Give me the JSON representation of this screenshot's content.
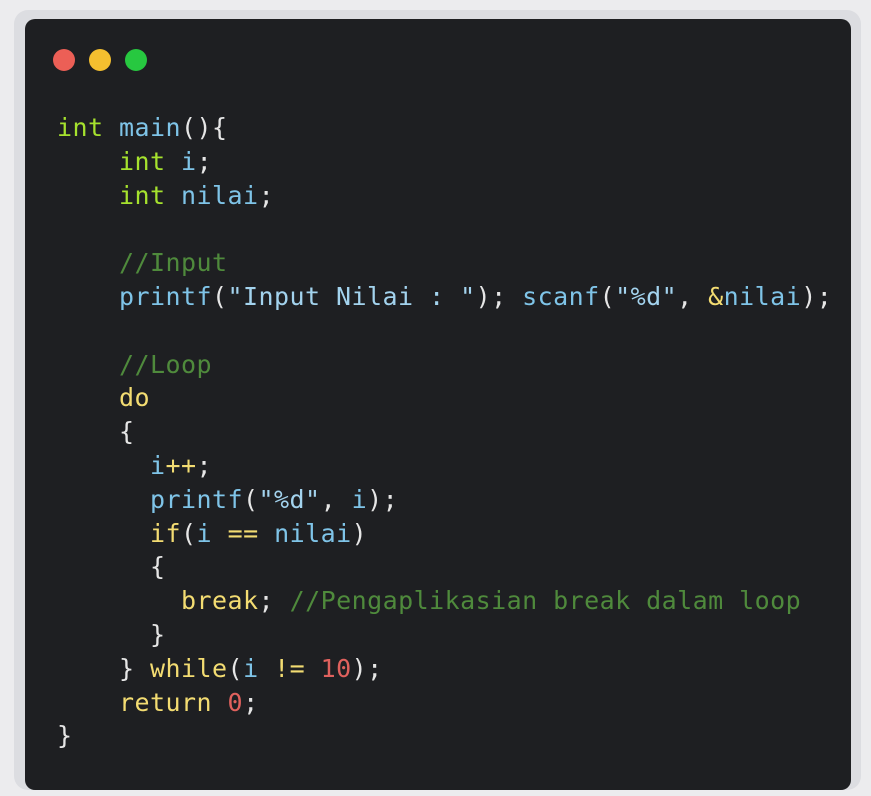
{
  "window": {
    "controls": [
      {
        "name": "close",
        "color": "#ec5f56"
      },
      {
        "name": "minimize",
        "color": "#f4bf2f"
      },
      {
        "name": "maximize",
        "color": "#27c840"
      }
    ]
  },
  "theme": {
    "background": "#1e1f22",
    "colors": {
      "type": "#a6e22e",
      "fn": "#7fc4e8",
      "ident": "#7fc4e8",
      "punct": "#e6e6e6",
      "str": "#a3d3ee",
      "comment": "#4f8a3c",
      "kw": "#f3dc72",
      "op": "#f3dc72",
      "num": "#e0615d",
      "plain": "#cdd3de"
    }
  },
  "code": {
    "lines": [
      [
        [
          "type",
          "int"
        ],
        [
          "plain",
          " "
        ],
        [
          "fn",
          "main"
        ],
        [
          "punct",
          "(){"
        ]
      ],
      [
        [
          "plain",
          "    "
        ],
        [
          "type",
          "int"
        ],
        [
          "plain",
          " "
        ],
        [
          "ident",
          "i"
        ],
        [
          "punct",
          ";"
        ]
      ],
      [
        [
          "plain",
          "    "
        ],
        [
          "type",
          "int"
        ],
        [
          "plain",
          " "
        ],
        [
          "ident",
          "nilai"
        ],
        [
          "punct",
          ";"
        ]
      ],
      [],
      [
        [
          "plain",
          "    "
        ],
        [
          "comment",
          "//Input"
        ]
      ],
      [
        [
          "plain",
          "    "
        ],
        [
          "fn",
          "printf"
        ],
        [
          "punct",
          "("
        ],
        [
          "str",
          "\"Input Nilai : \""
        ],
        [
          "punct",
          "); "
        ],
        [
          "fn",
          "scanf"
        ],
        [
          "punct",
          "("
        ],
        [
          "str",
          "\"%d\""
        ],
        [
          "punct",
          ", "
        ],
        [
          "op",
          "&"
        ],
        [
          "ident",
          "nilai"
        ],
        [
          "punct",
          ");"
        ]
      ],
      [],
      [
        [
          "plain",
          "    "
        ],
        [
          "comment",
          "//Loop"
        ]
      ],
      [
        [
          "plain",
          "    "
        ],
        [
          "kw",
          "do"
        ]
      ],
      [
        [
          "plain",
          "    "
        ],
        [
          "punct",
          "{"
        ]
      ],
      [
        [
          "plain",
          "      "
        ],
        [
          "ident",
          "i"
        ],
        [
          "op",
          "++"
        ],
        [
          "punct",
          ";"
        ]
      ],
      [
        [
          "plain",
          "      "
        ],
        [
          "fn",
          "printf"
        ],
        [
          "punct",
          "("
        ],
        [
          "str",
          "\"%d\""
        ],
        [
          "punct",
          ", "
        ],
        [
          "ident",
          "i"
        ],
        [
          "punct",
          ");"
        ]
      ],
      [
        [
          "plain",
          "      "
        ],
        [
          "kw",
          "if"
        ],
        [
          "punct",
          "("
        ],
        [
          "ident",
          "i"
        ],
        [
          "plain",
          " "
        ],
        [
          "op",
          "=="
        ],
        [
          "plain",
          " "
        ],
        [
          "ident",
          "nilai"
        ],
        [
          "punct",
          ")"
        ]
      ],
      [
        [
          "plain",
          "      "
        ],
        [
          "punct",
          "{"
        ]
      ],
      [
        [
          "plain",
          "        "
        ],
        [
          "kw",
          "break"
        ],
        [
          "punct",
          ";"
        ],
        [
          "plain",
          " "
        ],
        [
          "comment",
          "//Pengaplikasian break dalam loop"
        ]
      ],
      [
        [
          "plain",
          "      "
        ],
        [
          "punct",
          "}"
        ]
      ],
      [
        [
          "plain",
          "    "
        ],
        [
          "punct",
          "} "
        ],
        [
          "kw",
          "while"
        ],
        [
          "punct",
          "("
        ],
        [
          "ident",
          "i"
        ],
        [
          "plain",
          " "
        ],
        [
          "op",
          "!="
        ],
        [
          "plain",
          " "
        ],
        [
          "num",
          "10"
        ],
        [
          "punct",
          ");"
        ]
      ],
      [
        [
          "plain",
          "    "
        ],
        [
          "kw",
          "return"
        ],
        [
          "plain",
          " "
        ],
        [
          "num",
          "0"
        ],
        [
          "punct",
          ";"
        ]
      ],
      [
        [
          "punct",
          "}"
        ]
      ]
    ]
  }
}
